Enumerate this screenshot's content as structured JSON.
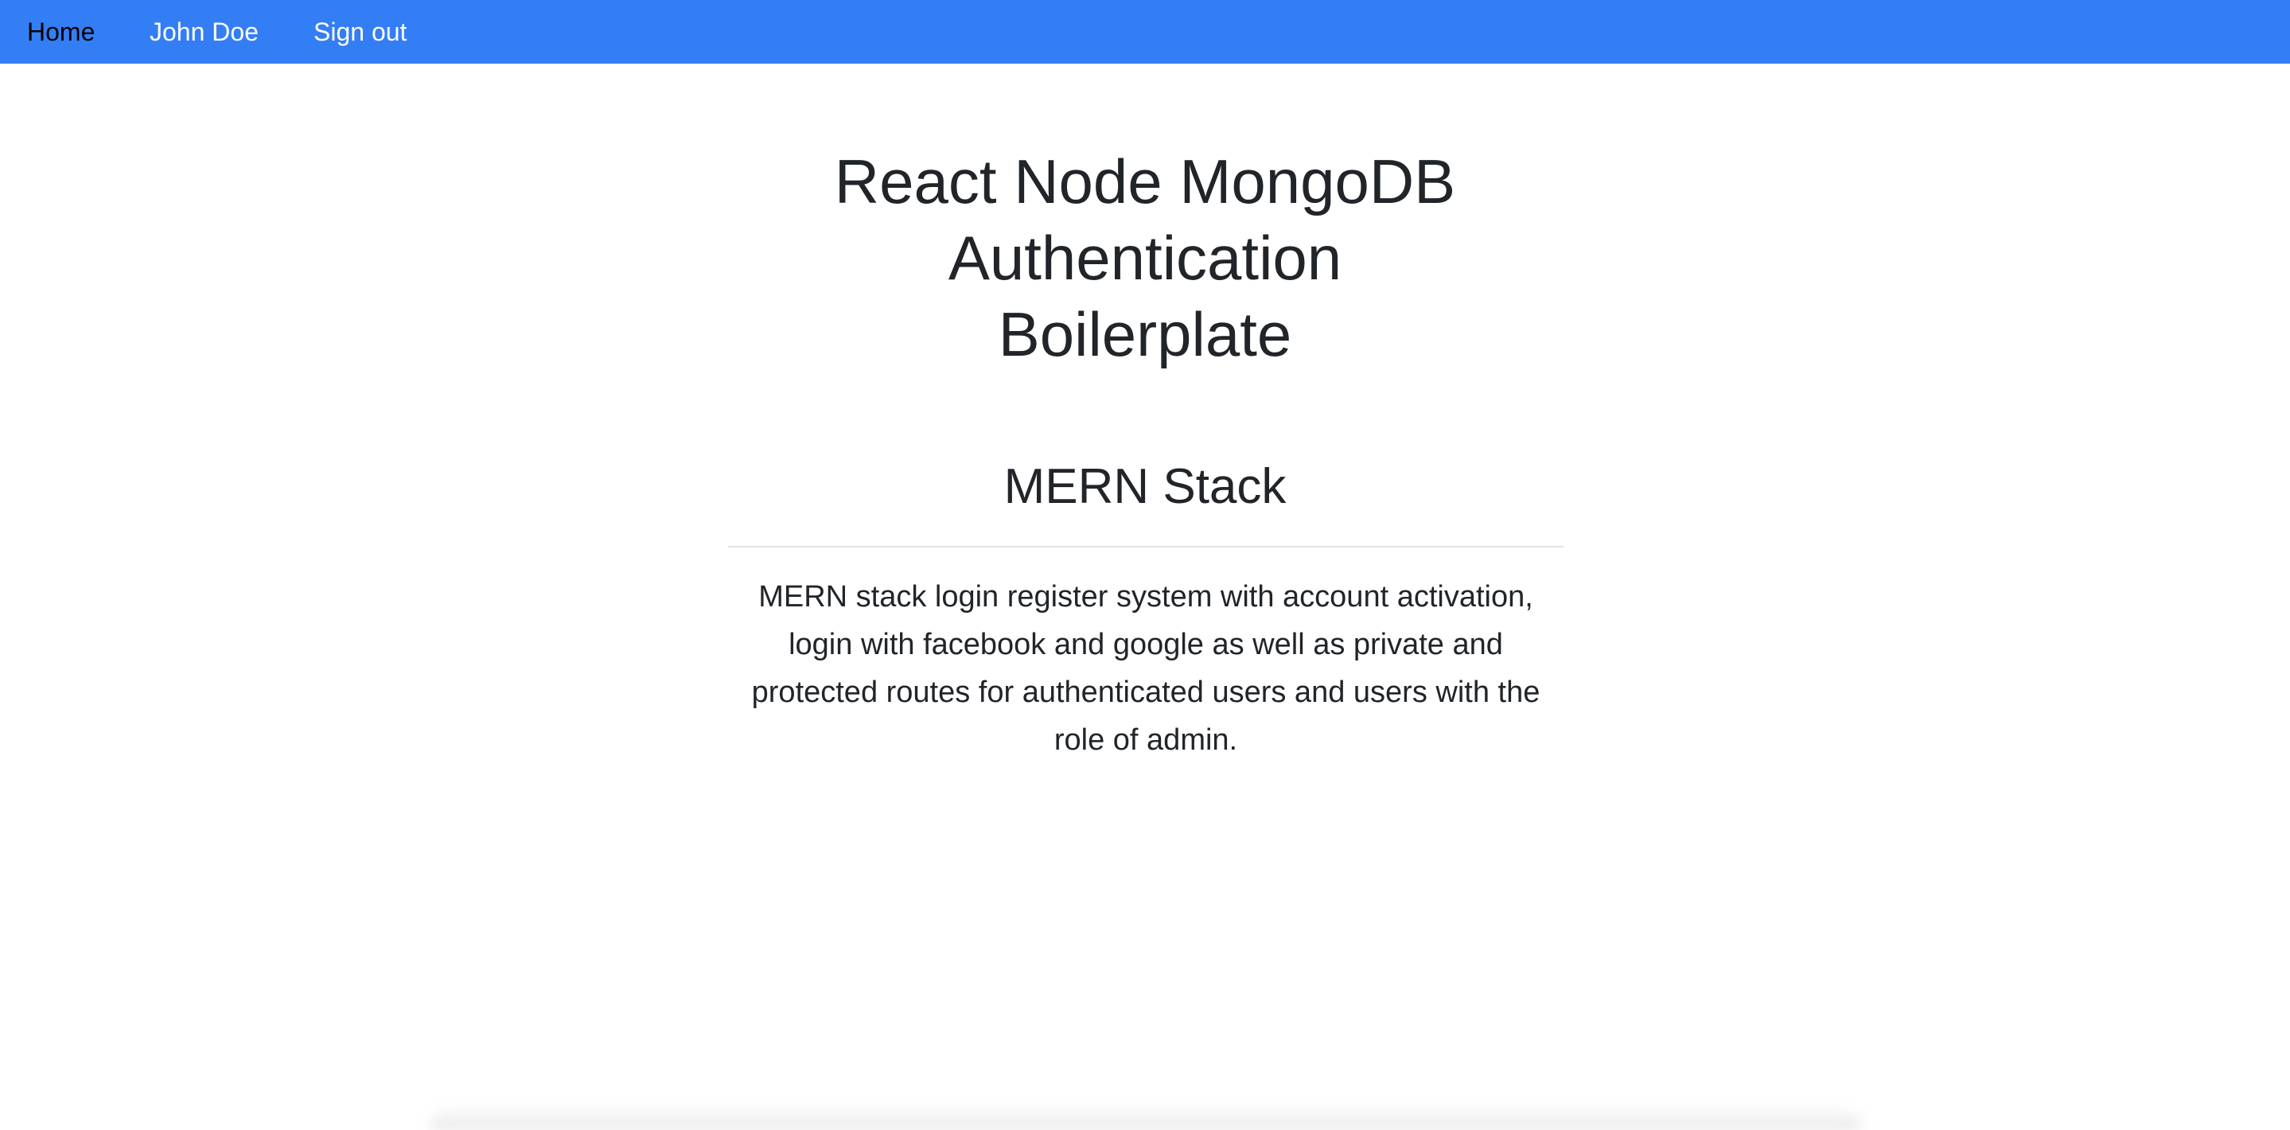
{
  "navbar": {
    "background": "#337ef5",
    "items": [
      {
        "label": "Home",
        "active": true
      },
      {
        "label": "John Doe",
        "active": false
      },
      {
        "label": "Sign out",
        "active": false
      }
    ]
  },
  "main": {
    "hero_title": {
      "line1": "React Node MongoDB",
      "line2": "Authentication",
      "line3": "Boilerplate"
    },
    "section_title": "MERN Stack",
    "description": "MERN stack login register system with account activation, login with facebook and google as well as private and protected routes for authenticated users and users with the role of admin."
  }
}
